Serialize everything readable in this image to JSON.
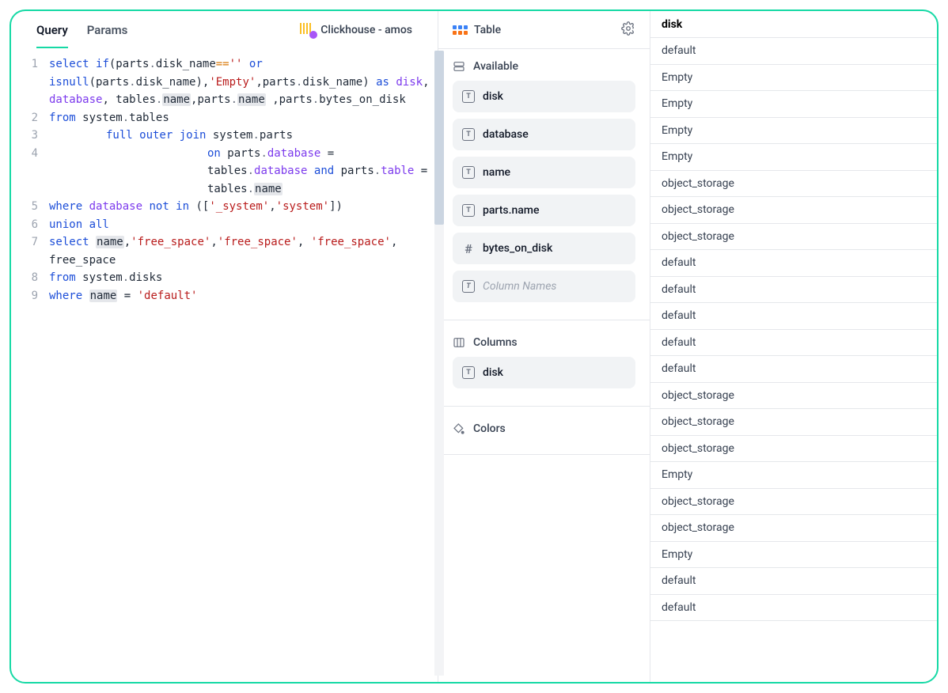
{
  "header": {
    "tabs": [
      {
        "label": "Query",
        "active": true
      },
      {
        "label": "Params",
        "active": false
      }
    ],
    "datasource": "Clickhouse - amos"
  },
  "editor": {
    "lines": [
      {
        "n": 1,
        "h": 3
      },
      {
        "n": 2,
        "h": 1
      },
      {
        "n": 3,
        "h": 1
      },
      {
        "n": 4,
        "h": 3
      },
      {
        "n": 5,
        "h": 1
      },
      {
        "n": 6,
        "h": 1
      },
      {
        "n": 7,
        "h": 2
      },
      {
        "n": 8,
        "h": 1
      },
      {
        "n": 9,
        "h": 1
      }
    ],
    "sql_tokens": {
      "l1a": "select",
      "l1b": "if",
      "l1c": "(parts",
      "l1d": ".",
      "l1e": "disk_name",
      "l1f": "==",
      "l1g": "''",
      "l1h": "or",
      "l1i": "isnull",
      "l1j": "(parts",
      "l1k": ".",
      "l1l": "disk_name",
      "l1m": "),",
      "l1n": "'Empty'",
      "l1o": ",parts",
      "l1p": ".",
      "l1q": "disk_name",
      "l1r": ")",
      "l1s": "as",
      "l1t": "disk",
      "l1u": ",",
      "l1v": "database",
      "l1w": ", tables",
      "l1x": ".",
      "l1y": "name",
      "l1z": ",parts",
      "l1aa": ".",
      "l1ab": "name",
      "l1ac": " ,parts",
      "l1ad": ".",
      "l1ae": "bytes_on_disk",
      "l2a": "from",
      "l2b": " system",
      "l2c": ".",
      "l2d": "tables",
      "l3a": "full outer join",
      "l3b": " system",
      "l3c": ".",
      "l3d": "parts",
      "l4a": "on",
      "l4b": " parts",
      "l4c": ".",
      "l4d": "database",
      "l4e": " = tables",
      "l4f": ".",
      "l4g": "database",
      "l4h": "and",
      "l4i": "parts",
      "l4j": ".",
      "l4k": "table",
      "l4l": " = tables",
      "l4m": ".",
      "l4n": "name",
      "l5a": "where",
      "l5b": "database",
      "l5c": "not in",
      "l5d": " ([",
      "l5e": "'_system'",
      "l5f": ",",
      "l5g": "'system'",
      "l5h": "])",
      "l6a": "union all",
      "l7a": "select",
      "l7b": "name",
      "l7c": ",",
      "l7d": "'free_space'",
      "l7e": ",",
      "l7f": "'free_space'",
      "l7g": ",",
      "l7h": "'free_space'",
      "l7i": ", free_space",
      "l8a": "from",
      "l8b": " system",
      "l8c": ".",
      "l8d": "disks",
      "l9a": "where",
      "l9b": "name",
      "l9c": " = ",
      "l9d": "'default'"
    }
  },
  "config": {
    "title": "Table",
    "sections": {
      "available": {
        "label": "Available",
        "items": [
          {
            "type": "T",
            "label": "disk"
          },
          {
            "type": "T",
            "label": "database"
          },
          {
            "type": "T",
            "label": "name"
          },
          {
            "type": "T",
            "label": "parts.name"
          },
          {
            "type": "#",
            "label": "bytes_on_disk"
          }
        ],
        "placeholder": "Column Names"
      },
      "columns": {
        "label": "Columns",
        "items": [
          {
            "type": "T",
            "label": "disk"
          }
        ]
      },
      "colors": {
        "label": "Colors"
      }
    }
  },
  "results": {
    "header": "disk",
    "rows": [
      "default",
      "Empty",
      "Empty",
      "Empty",
      "Empty",
      "object_storage",
      "object_storage",
      "object_storage",
      "default",
      "default",
      "default",
      "default",
      "default",
      "object_storage",
      "object_storage",
      "object_storage",
      "Empty",
      "object_storage",
      "object_storage",
      "Empty",
      "default",
      "default"
    ]
  }
}
